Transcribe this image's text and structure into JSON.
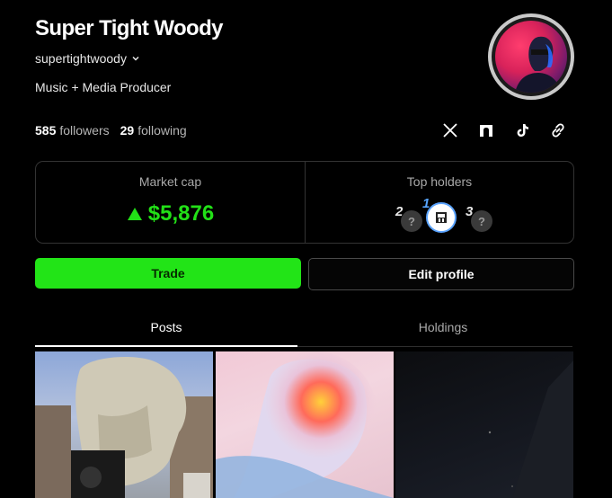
{
  "profile": {
    "display_name": "Super Tight Woody",
    "handle": "supertightwoody",
    "bio": "Music + Media Producer",
    "followers_count": "585",
    "followers_label": "followers",
    "following_count": "29",
    "following_label": "following"
  },
  "socials": [
    "x-icon",
    "arch-icon",
    "tiktok-icon",
    "link-icon"
  ],
  "stats_card": {
    "market_cap_label": "Market cap",
    "market_cap_value": "$5,876",
    "top_holders_label": "Top holders",
    "holders": [
      {
        "rank": "2",
        "glyph": "?"
      },
      {
        "rank": "1",
        "glyph": "▣"
      },
      {
        "rank": "3",
        "glyph": "?"
      }
    ]
  },
  "actions": {
    "trade_label": "Trade",
    "edit_label": "Edit profile"
  },
  "tabs": [
    {
      "label": "Posts",
      "active": true
    },
    {
      "label": "Holdings",
      "active": false
    }
  ],
  "colors": {
    "accent_green": "#22e417",
    "market_up": "#22e017",
    "active_holder_ring": "#5aa3ff"
  }
}
